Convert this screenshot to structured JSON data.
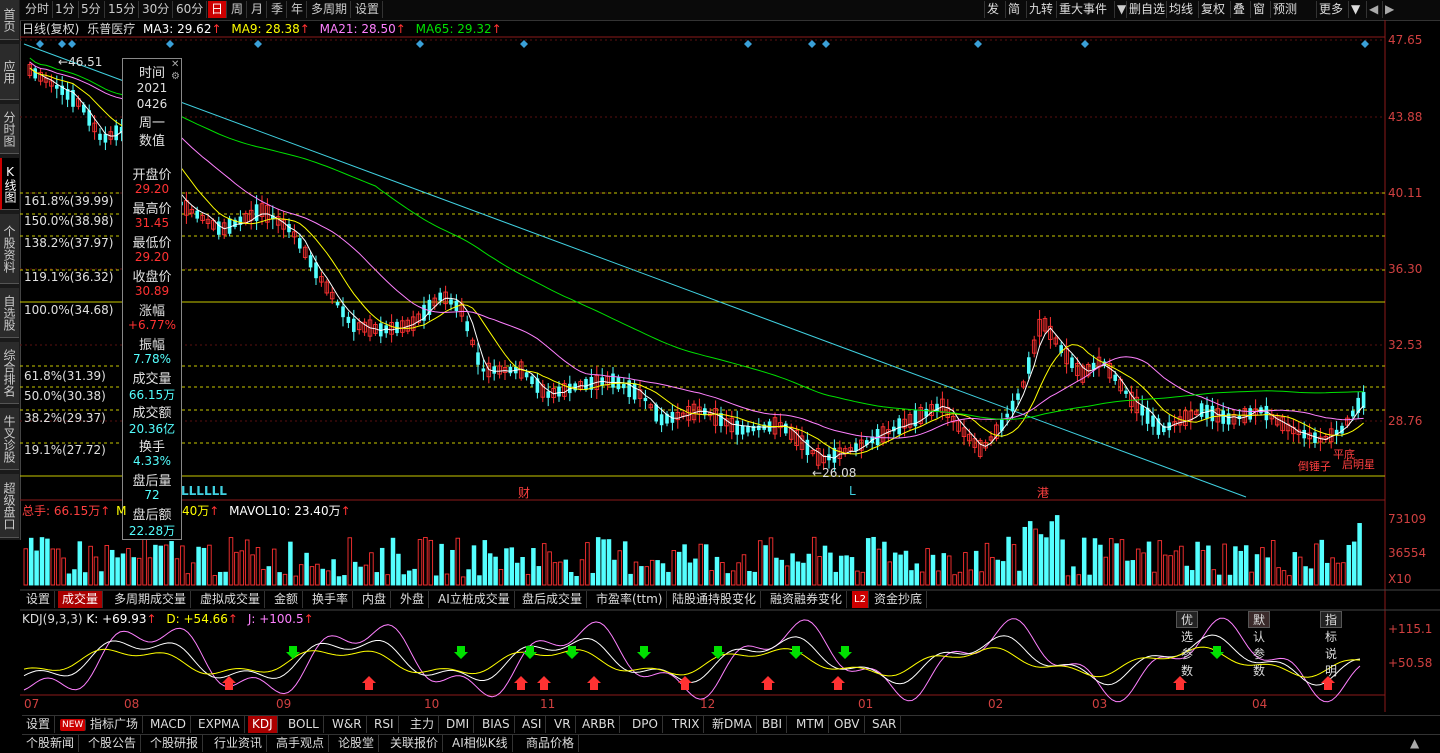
{
  "left_tabs": [
    "首页",
    "应用",
    "分时图",
    "K线图",
    "个股资料",
    "自选股",
    "综合排名",
    "牛叉诊股",
    "超级盘口"
  ],
  "period_tabs": [
    "分时",
    "1分",
    "5分",
    "15分",
    "30分",
    "60分",
    "日",
    "周",
    "月",
    "季",
    "年",
    "多周期",
    "设置"
  ],
  "active_period": "日",
  "top_right_buttons": [
    "发",
    "简",
    "九转",
    "重大事件",
    "删自选",
    "均线",
    "复权",
    "叠",
    "窗",
    "预测",
    "更多"
  ],
  "ma_bar": {
    "period": "日线(复权)",
    "stock": "乐普医疗",
    "ma3": "MA3: 29.62",
    "ma9": "MA9: 28.38",
    "ma21": "MA21: 28.50",
    "ma65": "MA65: 29.32",
    "arrow": "↑"
  },
  "price_axis": [
    "47.65",
    "43.88",
    "40.11",
    "36.30",
    "32.53",
    "28.76"
  ],
  "fib_levels": [
    "161.8%(39.99)",
    "150.0%(38.98)",
    "138.2%(37.97)",
    "119.1%(36.32)",
    "100.0%(34.68)",
    "61.8%(31.39)",
    "50.0%(30.38)",
    "38.2%(29.37)",
    "19.1%(27.72)"
  ],
  "chart_labels": {
    "high": "46.51",
    "low": "26.08",
    "event_cai": "财",
    "event_l": "L",
    "event_gang": "港",
    "llll": "LLLLLL",
    "pattern1": "倒锤子",
    "pattern2": "平底",
    "pattern3": "启明星"
  },
  "tooltip": {
    "rows": [
      {
        "label": "时间",
        "value": "2021"
      },
      {
        "label": "",
        "value": "0426"
      },
      {
        "label": "",
        "value": "周一"
      },
      {
        "label": "数值",
        "value": ""
      },
      {
        "label": "开盘价",
        "value": "29.20"
      },
      {
        "label": "最高价",
        "value": "31.45"
      },
      {
        "label": "最低价",
        "value": "29.20"
      },
      {
        "label": "收盘价",
        "value": "30.89"
      },
      {
        "label": "涨幅",
        "value": "+6.77%"
      },
      {
        "label": "振幅",
        "value": "7.78%"
      },
      {
        "label": "成交量",
        "value": "66.15万"
      },
      {
        "label": "成交额",
        "value": "20.36亿"
      },
      {
        "label": "换手",
        "value": "4.33%"
      },
      {
        "label": "盘后量",
        "value": "72"
      },
      {
        "label": "盘后额",
        "value": "22.28万"
      }
    ]
  },
  "volume_bar": {
    "total": "总手: 66.15万",
    "arrow": "↑",
    "mavol5_tail": "40万",
    "mavol10": "MAVOL10: 23.40万"
  },
  "volume_axis": [
    "73109",
    "36554",
    "X10"
  ],
  "indicator_tabs": [
    "设置",
    "成交量",
    "多周期成交量",
    "虚拟成交量",
    "金额",
    "换手率",
    "内盘",
    "外盘",
    "AI立桩成交量",
    "盘后成交量",
    "市盈率(ttm)",
    "陆股通持股变化",
    "融资融券变化",
    "L2",
    "资金抄底"
  ],
  "active_indicator_tab": "成交量",
  "param_buttons": [
    "优选参数",
    "默认参数",
    "指标说明"
  ],
  "kdj_bar": {
    "name": "KDJ(9,3,3)",
    "k": "K: +69.93",
    "d": "D: +54.66",
    "j": "J: +100.5"
  },
  "kdj_axis": [
    "+115.1",
    "+50.58"
  ],
  "month_labels": [
    "07",
    "08",
    "09",
    "10",
    "11",
    "12",
    "01",
    "02",
    "03",
    "04"
  ],
  "indicator_list": [
    "设置",
    "NEW",
    "指标广场",
    "MACD",
    "EXPMA",
    "KDJ",
    "BOLL",
    "W&R",
    "RSI",
    "主力",
    "DMI",
    "BIAS",
    "ASI",
    "VR",
    "ARBR",
    "DPO",
    "TRIX",
    "新DMA",
    "BBI",
    "MTM",
    "OBV",
    "SAR"
  ],
  "active_indicator": "KDJ",
  "news_tabs": [
    "个股新闻",
    "个股公告",
    "个股研报",
    "行业资讯",
    "高手观点",
    "论股堂",
    "关联报价",
    "AI相似K线",
    "商品价格"
  ],
  "colors": {
    "up": "#ff3232",
    "down": "#54ffff",
    "ma3": "#ffffff",
    "ma9": "#ffff00",
    "ma21": "#ff80ff",
    "ma65": "#00e000",
    "trend": "#40d0e0",
    "fib": "#c8c800"
  }
}
